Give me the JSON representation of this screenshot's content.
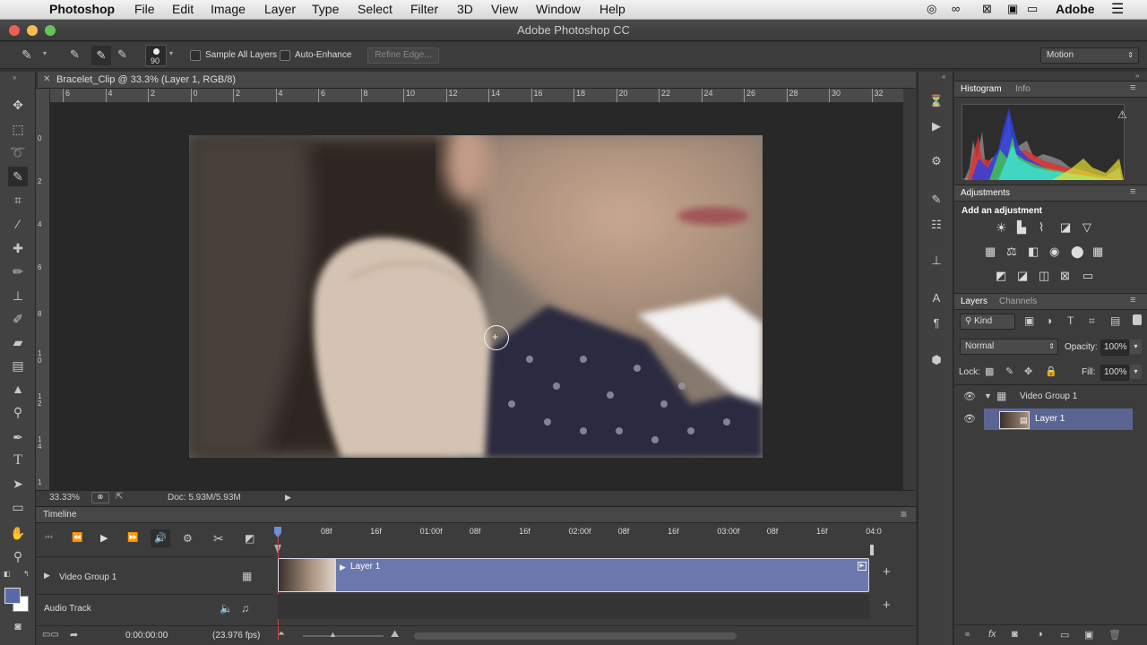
{
  "menubar": {
    "app": "Photoshop",
    "items": [
      "File",
      "Edit",
      "Image",
      "Layer",
      "Type",
      "Select",
      "Filter",
      "3D",
      "View",
      "Window",
      "Help"
    ],
    "right_label": "Adobe"
  },
  "window": {
    "title": "Adobe Photoshop CC"
  },
  "options": {
    "brush_size": "90",
    "sample_all_layers": "Sample All Layers",
    "auto_enhance": "Auto-Enhance",
    "refine_edge": "Refine Edge...",
    "workspace": "Motion"
  },
  "document": {
    "tab_title": "Bracelet_Clip @ 33.3% (Layer 1, RGB/8)",
    "hruler_ticks": [
      "6",
      "4",
      "2",
      "0",
      "2",
      "4",
      "6",
      "8",
      "10",
      "12",
      "14",
      "16",
      "18",
      "20",
      "22",
      "24",
      "26",
      "28",
      "30",
      "32"
    ],
    "vruler_ticks": [
      "0",
      "2",
      "4",
      "6",
      "8",
      "1 0",
      "1 2",
      "1 4",
      "1"
    ],
    "zoom": "33.33%",
    "doc_size": "Doc: 5.93M/5.93M"
  },
  "timeline": {
    "title": "Timeline",
    "ruler": [
      "08f",
      "16f",
      "01:00f",
      "08f",
      "16f",
      "02:00f",
      "08f",
      "16f",
      "03:00f",
      "08f",
      "16f",
      "04:0"
    ],
    "video_group": "Video Group 1",
    "clip_label": "Layer 1",
    "audio_track": "Audio Track",
    "timecode": "0:00:00:00",
    "fps": "(23.976 fps)"
  },
  "panels": {
    "histogram_tab": "Histogram",
    "info_tab": "Info",
    "adjustments_tab": "Adjustments",
    "add_adjustment": "Add an adjustment",
    "layers_tab": "Layers",
    "channels_tab": "Channels",
    "kind": "Kind",
    "blend_mode": "Normal",
    "opacity_label": "Opacity:",
    "opacity": "100%",
    "lock_label": "Lock:",
    "fill_label": "Fill:",
    "fill": "100%",
    "layers": [
      {
        "name": "Video Group 1"
      },
      {
        "name": "Layer 1"
      }
    ]
  },
  "colors": {
    "accent": "#6a78ad",
    "selected_layer": "#5b6593"
  }
}
